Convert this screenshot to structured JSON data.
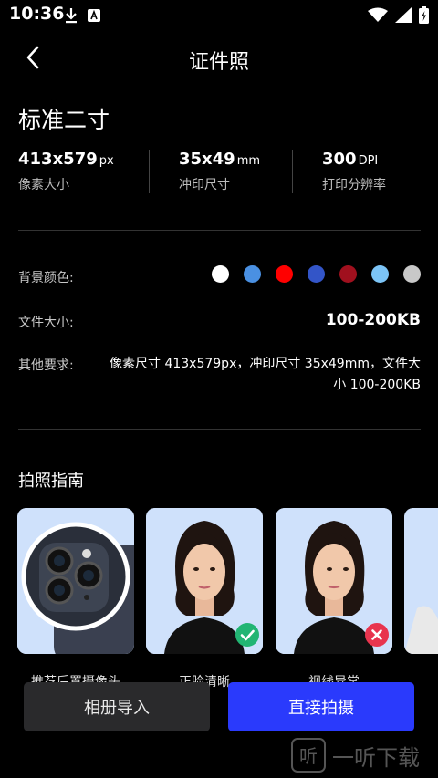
{
  "status_bar": {
    "time": "10:36"
  },
  "nav": {
    "title": "证件照"
  },
  "spec": {
    "title": "标准二寸",
    "pixel_size": {
      "value": "413x579",
      "unit": "px",
      "label": "像素大小"
    },
    "print_size": {
      "value": "35x49",
      "unit": "mm",
      "label": "冲印尺寸"
    },
    "dpi": {
      "value": "300",
      "unit": "DPI",
      "label": "打印分辨率"
    }
  },
  "background": {
    "label": "背景颜色:",
    "colors": [
      "#ffffff",
      "#4a90e2",
      "#ff0000",
      "#3355c8",
      "#a0101e",
      "#7cc4f6",
      "#c8c8c8"
    ]
  },
  "file_size": {
    "label": "文件大小:",
    "value": "100-200KB"
  },
  "other_requirements": {
    "label": "其他要求:",
    "value": "像素尺寸 413x579px，冲印尺寸 35x49mm，文件大小 100-200KB"
  },
  "guide": {
    "title": "拍照指南",
    "cards": [
      {
        "caption": "推荐后置摄像头",
        "icon": "rear-camera-icon"
      },
      {
        "caption": "正脸清晰",
        "badge": "check-icon",
        "badge_color": "#22b573"
      },
      {
        "caption": "视线异常",
        "badge": "close-icon",
        "badge_color": "#e8344e"
      }
    ]
  },
  "actions": {
    "album_label": "相册导入",
    "shoot_label": "直接拍摄"
  },
  "watermark": {
    "text": "一听下载"
  }
}
